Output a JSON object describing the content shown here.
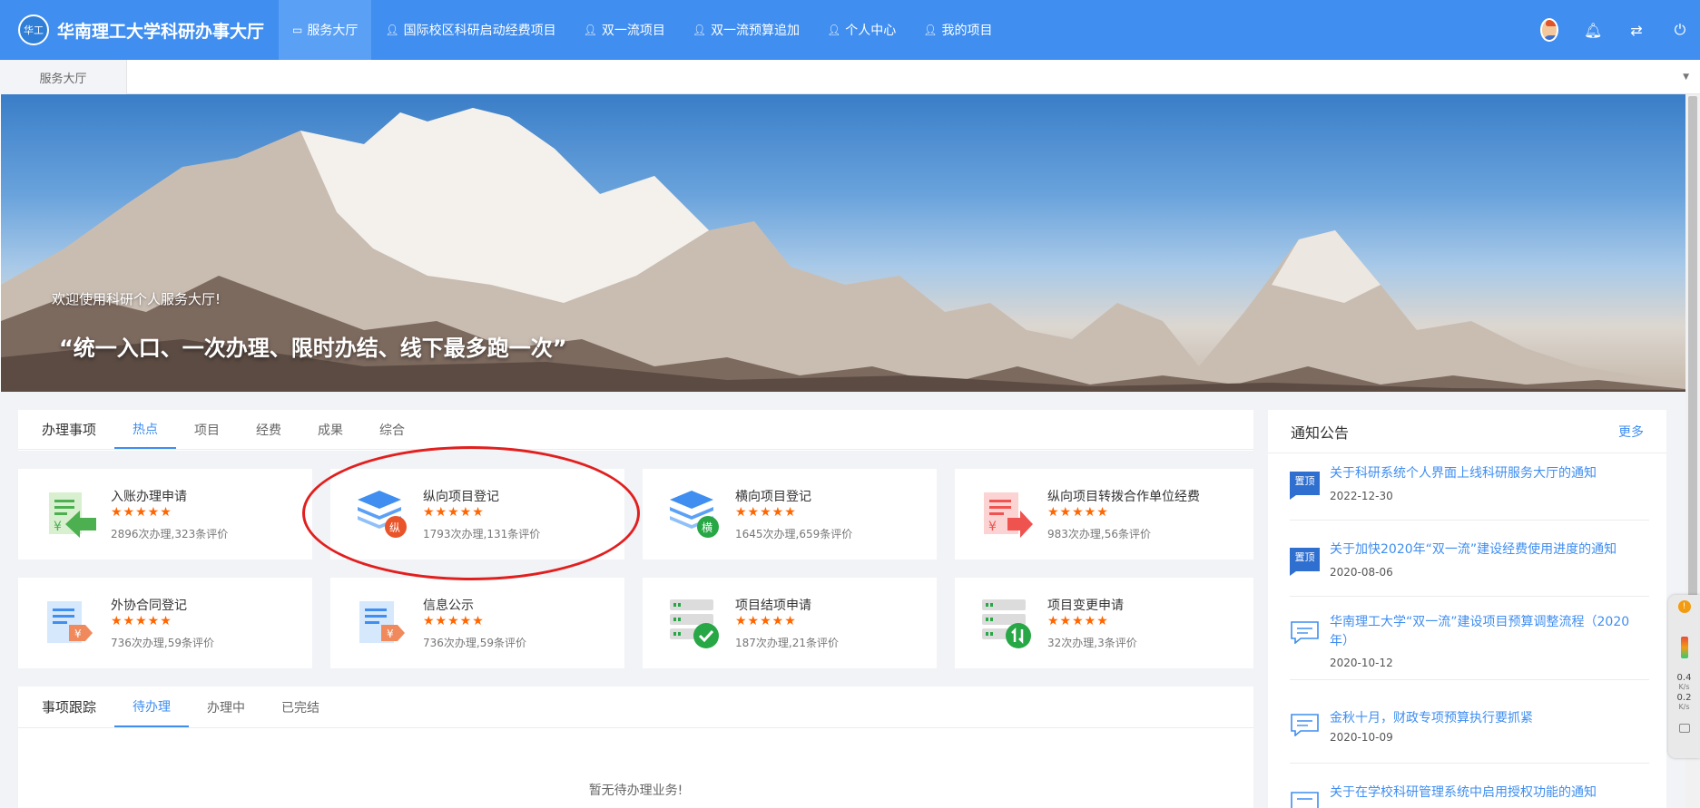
{
  "app": {
    "logo_text": "华工",
    "title": "华南理工大学科研办事大厅"
  },
  "nav": [
    {
      "label": "服务大厅",
      "icon": "monitor-icon"
    },
    {
      "label": "国际校区科研启动经费项目",
      "icon": "user-icon"
    },
    {
      "label": "双一流项目",
      "icon": "user-icon"
    },
    {
      "label": "双一流预算追加",
      "icon": "user-icon"
    },
    {
      "label": "个人中心",
      "icon": "user-icon"
    },
    {
      "label": "我的项目",
      "icon": "user-icon"
    }
  ],
  "topright": {
    "icons": [
      "avatar",
      "bell-icon",
      "shuffle-icon",
      "power-icon"
    ]
  },
  "tabstrip": {
    "open_tab": "服务大厅"
  },
  "banner": {
    "welcome": "欢迎使用科研个人服务大厅!",
    "slogan": "“统一入口、一次办理、限时办结、线下最多跑一次”"
  },
  "handling": {
    "title": "办理事项",
    "tabs": [
      "热点",
      "项目",
      "经费",
      "成果",
      "综合"
    ],
    "active_tab": "热点",
    "services": [
      {
        "name": "入账办理申请",
        "stars": "★★★★★",
        "meta": "2896次办理,323条评价",
        "icon": "entry-money-icon"
      },
      {
        "name": "纵向项目登记",
        "stars": "★★★★★",
        "meta": "1793次办理,131条评价",
        "icon": "layers-vertical-icon",
        "badge": "纵"
      },
      {
        "name": "横向项目登记",
        "stars": "★★★★★",
        "meta": "1645次办理,659条评价",
        "icon": "layers-horizontal-icon",
        "badge": "横"
      },
      {
        "name": "纵向项目转拨合作单位经费",
        "stars": "★★★★★",
        "meta": "983次办理,56条评价",
        "icon": "transfer-money-icon"
      },
      {
        "name": "外协合同登记",
        "stars": "★★★★★",
        "meta": "736次办理,59条评价",
        "icon": "contract-icon"
      },
      {
        "name": "信息公示",
        "stars": "★★★★★",
        "meta": "736次办理,59条评价",
        "icon": "publicity-icon"
      },
      {
        "name": "项目结项申请",
        "stars": "★★★★★",
        "meta": "187次办理,21条评价",
        "icon": "server-check-icon"
      },
      {
        "name": "项目变更申请",
        "stars": "★★★★★",
        "meta": "32次办理,3条评价",
        "icon": "server-change-icon"
      }
    ]
  },
  "tracking": {
    "title": "事项跟踪",
    "tabs": [
      "待办理",
      "办理中",
      "已完结"
    ],
    "active_tab": "待办理",
    "empty": "暂无待办理业务!"
  },
  "notice": {
    "title": "通知公告",
    "more": "更多",
    "items": [
      {
        "title": "关于科研系统个人界面上线科研服务大厅的通知",
        "date": "2022-12-30",
        "pinned": true,
        "badge": "置顶"
      },
      {
        "title": "关于加快2020年“双一流”建设经费使用进度的通知",
        "date": "2020-08-06",
        "pinned": true,
        "badge": "置顶"
      },
      {
        "title": "华南理工大学“双一流”建设项目预算调整流程（2020年）",
        "date": "2020-10-12",
        "pinned": false
      },
      {
        "title": "金秋十月，财政专项预算执行要抓紧",
        "date": "2020-10-09",
        "pinned": false
      },
      {
        "title": "关于在学校科研管理系统中启用授权功能的通知",
        "date": "",
        "pinned": false
      }
    ]
  },
  "widget": {
    "up_speed": "0.4",
    "down_speed": "0.2",
    "unit": "K/s"
  },
  "colors": {
    "primary": "#3f8ef0",
    "star": "#ff6600",
    "annotation": "#e21f1f"
  }
}
